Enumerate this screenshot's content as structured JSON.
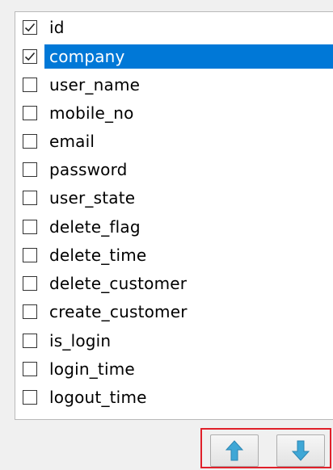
{
  "field_list": {
    "items": [
      {
        "label": "id",
        "checked": true,
        "selected": false
      },
      {
        "label": "company",
        "checked": true,
        "selected": true
      },
      {
        "label": "user_name",
        "checked": false,
        "selected": false
      },
      {
        "label": "mobile_no",
        "checked": false,
        "selected": false
      },
      {
        "label": "email",
        "checked": false,
        "selected": false
      },
      {
        "label": "password",
        "checked": false,
        "selected": false
      },
      {
        "label": "user_state",
        "checked": false,
        "selected": false
      },
      {
        "label": "delete_flag",
        "checked": false,
        "selected": false
      },
      {
        "label": "delete_time",
        "checked": false,
        "selected": false
      },
      {
        "label": "delete_customer",
        "checked": false,
        "selected": false
      },
      {
        "label": "create_customer",
        "checked": false,
        "selected": false
      },
      {
        "label": "is_login",
        "checked": false,
        "selected": false
      },
      {
        "label": "login_time",
        "checked": false,
        "selected": false
      },
      {
        "label": "logout_time",
        "checked": false,
        "selected": false
      }
    ]
  },
  "move_buttons": {
    "up_icon": "arrow-up-icon",
    "down_icon": "arrow-down-icon"
  },
  "colors": {
    "selection": "#0078d7",
    "arrow": "#3fa7d6",
    "highlight_frame": "#e0202a"
  }
}
